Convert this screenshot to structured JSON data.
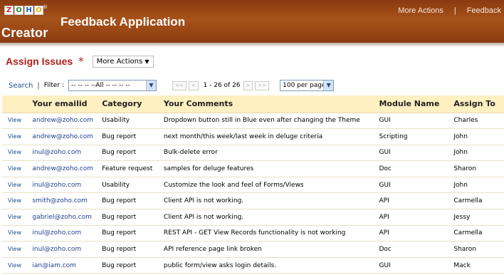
{
  "header": {
    "logo_letters": [
      "Z",
      "O",
      "H",
      "O"
    ],
    "logo_trademark": "®",
    "logo_product": "Creator",
    "app_title": "Feedback Application",
    "links": [
      "More Actions",
      "Feedback"
    ],
    "separator": "|"
  },
  "page": {
    "title": "Assign Issues",
    "asterisk": "*",
    "more_actions_label": "More Actions",
    "more_actions_arrow": "▼"
  },
  "toolbar": {
    "search_label": "Search",
    "pipe": "|",
    "filter_label": "Filter :",
    "filter_value": "-- -- -- --All -- -- -- --",
    "pager_first": "<<",
    "pager_prev": "<",
    "pager_info": "1 - 26 of 26",
    "pager_next": ">",
    "pager_last": ">>",
    "per_page_value": "100 per page",
    "dropdown_arrow": "▼"
  },
  "table": {
    "columns": [
      "",
      "Your emailid",
      "Category",
      "Your Comments",
      "Module Name",
      "Assign To"
    ],
    "view_label": "View",
    "rows": [
      {
        "email": "andrew@zoho.com",
        "category": "Usability",
        "comment": "Dropdown button still in Blue even after changing the Theme",
        "module": "GUI",
        "assign": "Charles"
      },
      {
        "email": "andrew@zoho.com",
        "category": "Bug report",
        "comment": "next month/this week/last week in deluge criteria",
        "module": "Scripting",
        "assign": "John"
      },
      {
        "email": "inul@zoho.com",
        "category": "Bug report",
        "comment": "Bulk-delete error",
        "module": "GUI",
        "assign": "John"
      },
      {
        "email": "andrew@zoho.com",
        "category": "Feature request",
        "comment": "samples for deluge features",
        "module": "Doc",
        "assign": "Sharon"
      },
      {
        "email": "inul@zoho.com",
        "category": "Usability",
        "comment": "Customize the look and feel of Forms/Views",
        "module": "GUI",
        "assign": "John"
      },
      {
        "email": "smith@zoho.com",
        "category": "Bug report",
        "comment": "Client API is not working.",
        "module": "API",
        "assign": "Carmella"
      },
      {
        "email": "gabriel@zoho.com",
        "category": "Bug report",
        "comment": "Client API is not working.",
        "module": "API",
        "assign": "Jessy"
      },
      {
        "email": "inul@zoho.com",
        "category": "Bug report",
        "comment": "REST API - GET View Records functionality is not working",
        "module": "API",
        "assign": "Carmella"
      },
      {
        "email": "inul@zoho.com",
        "category": "Bug report",
        "comment": "API reference page link broken",
        "module": "Doc",
        "assign": "Sharon"
      },
      {
        "email": "ian@iam.com",
        "category": "Bug report",
        "comment": "public form/view asks login details.",
        "module": "GUI",
        "assign": "Mack"
      }
    ]
  }
}
